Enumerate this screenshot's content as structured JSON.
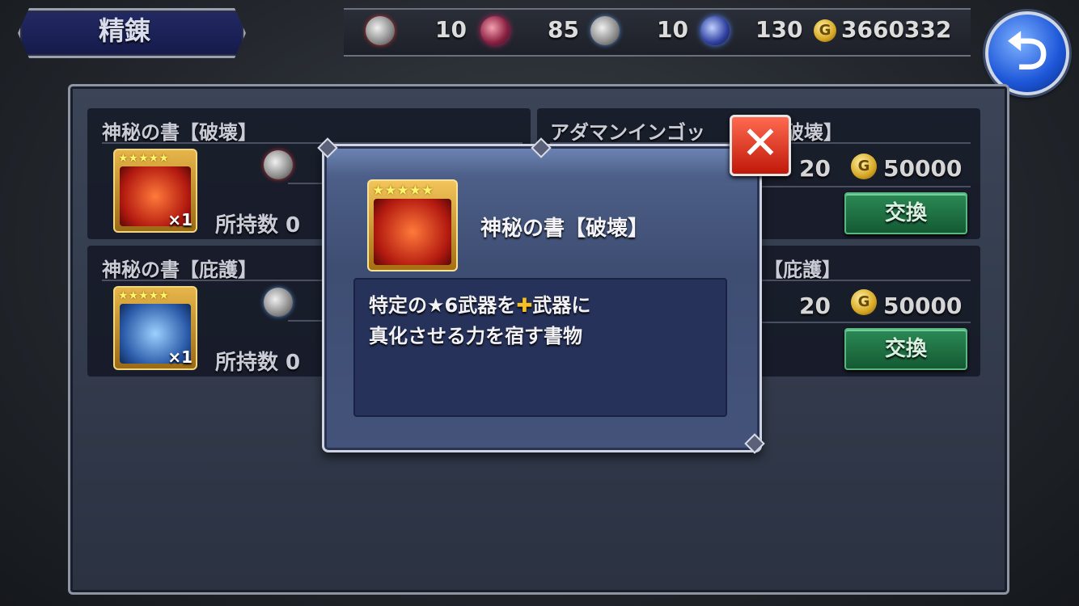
{
  "header": {
    "title": "精錬",
    "currencies": [
      {
        "icon": "crystal-red-icon",
        "value": "10"
      },
      {
        "icon": "crystal-pink-icon",
        "value": "85"
      },
      {
        "icon": "crystal-blue-icon",
        "value": "10"
      },
      {
        "icon": "crystal-violet-icon",
        "value": "130"
      }
    ],
    "gil_symbol": "G",
    "gil": "3660332",
    "back_icon": "back-arrow-icon"
  },
  "cards": [
    {
      "title": "神秘の書【破壊】",
      "stars": "★★★★★",
      "qty": "×1",
      "held": "所持数 0"
    },
    {
      "title": "アダマンインゴッ",
      "title_suffix": "破壊】",
      "cost": "20",
      "gil": "50000",
      "button": "交換"
    },
    {
      "title": "神秘の書【庇護】",
      "stars": "★★★★★",
      "qty": "×1",
      "held": "所持数 0"
    },
    {
      "title_suffix": "【庇護】",
      "cost": "20",
      "gil": "50000",
      "button": "交換"
    }
  ],
  "modal": {
    "stars": "★★★★★",
    "name": "神秘の書【破壊】",
    "desc_line1_a": "特定の★6武器を",
    "desc_plus": "✚",
    "desc_line1_b": "武器に",
    "desc_line2": "真化させる力を宿す書物",
    "close_icon": "close-icon"
  },
  "colors": {
    "exchange_button": "#1f7a46",
    "close_button": "#d8301c",
    "back_button": "#1c56d8"
  }
}
